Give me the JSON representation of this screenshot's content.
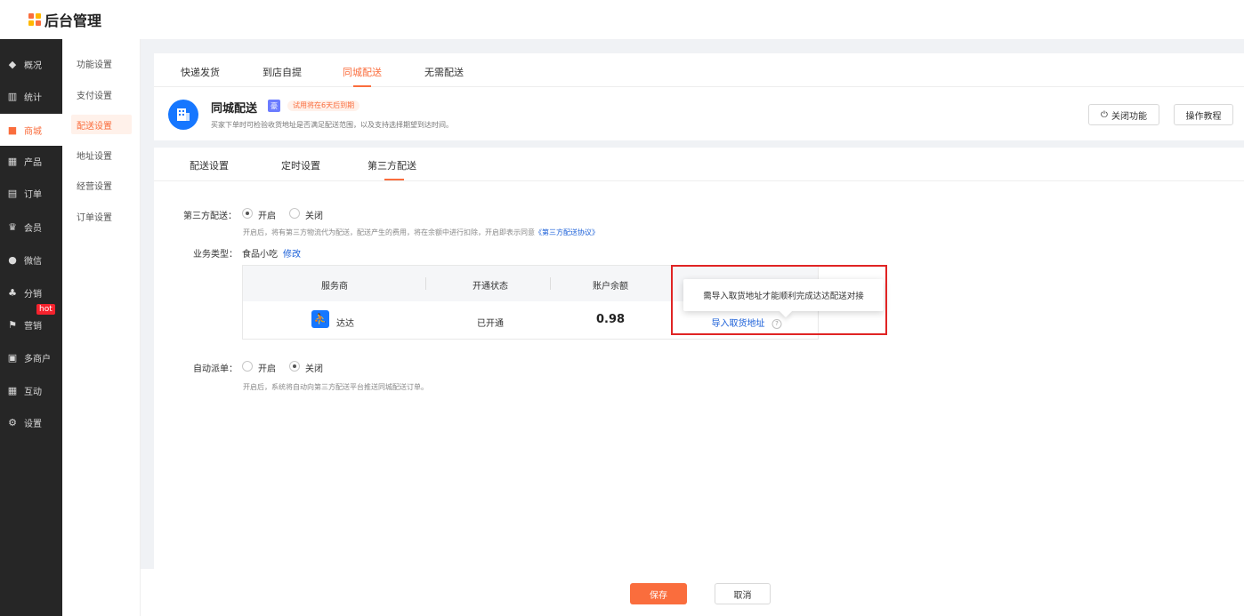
{
  "app": {
    "title": "后台管理"
  },
  "brand_colors": {
    "accent": "#fa6d3d",
    "sidebar_bg": "#262626",
    "link": "#1a5fd8",
    "highlight_box": "#e02424"
  },
  "sidebar": {
    "items": [
      {
        "label": "概况",
        "icon": "overview-icon"
      },
      {
        "label": "统计",
        "icon": "chart-icon"
      },
      {
        "label": "商城",
        "icon": "shop-icon",
        "active": true
      },
      {
        "label": "产品",
        "icon": "product-icon"
      },
      {
        "label": "订单",
        "icon": "order-icon"
      },
      {
        "label": "会员",
        "icon": "crown-icon"
      },
      {
        "label": "微信",
        "icon": "wechat-icon"
      },
      {
        "label": "分销",
        "icon": "distribution-icon"
      },
      {
        "label": "营销",
        "icon": "flag-icon",
        "badge": "hot"
      },
      {
        "label": "多商户",
        "icon": "merchant-icon"
      },
      {
        "label": "互动",
        "icon": "interaction-icon"
      },
      {
        "label": "设置",
        "icon": "gear-icon"
      }
    ]
  },
  "subnav": {
    "items": [
      {
        "label": "功能设置"
      },
      {
        "label": "支付设置"
      },
      {
        "label": "配送设置",
        "active": true
      },
      {
        "label": "地址设置"
      },
      {
        "label": "经营设置"
      },
      {
        "label": "订单设置"
      }
    ]
  },
  "delivery_tabs": [
    {
      "label": "快递发货"
    },
    {
      "label": "到店自提"
    },
    {
      "label": "同城配送",
      "active": true
    },
    {
      "label": "无需配送"
    }
  ],
  "feature": {
    "title": "同城配送",
    "vip_badge": "豪",
    "trial_tag": "试用将在6天后到期",
    "description": "买家下单时可检验收货地址是否满足配送范围，以及支持选择期望到达时间。",
    "close_button": "关闭功能",
    "tutorial_button": "操作教程"
  },
  "settings_tabs": [
    {
      "label": "配送设置"
    },
    {
      "label": "定时设置"
    },
    {
      "label": "第三方配送",
      "active": true
    }
  ],
  "third_party": {
    "label": "第三方配送：",
    "options": [
      "开启",
      "关闭"
    ],
    "selected": "开启",
    "hint_prefix": "开启后，将有第三方物流代为配送，配送产生的费用，将在余额中进行扣除，开启即表示同意",
    "agreement_link": "《第三方配送协议》"
  },
  "business_type": {
    "label": "业务类型：",
    "value": "食品小吃",
    "edit_link": "修改"
  },
  "provider_table": {
    "headers": [
      "服务商",
      "开通状态",
      "账户余额"
    ],
    "rows": [
      {
        "provider": "达达",
        "status": "已开通",
        "balance": "0.98",
        "action": "导入取货地址"
      }
    ]
  },
  "tooltip": {
    "text": "需导入取货地址才能顺利完成达达配送对接"
  },
  "auto_dispatch": {
    "label": "自动派单：",
    "options": [
      "开启",
      "关闭"
    ],
    "selected": "关闭",
    "hint": "开启后，系统将自动向第三方配送平台推送同城配送订单。"
  },
  "footer": {
    "save": "保存",
    "cancel": "取消"
  }
}
